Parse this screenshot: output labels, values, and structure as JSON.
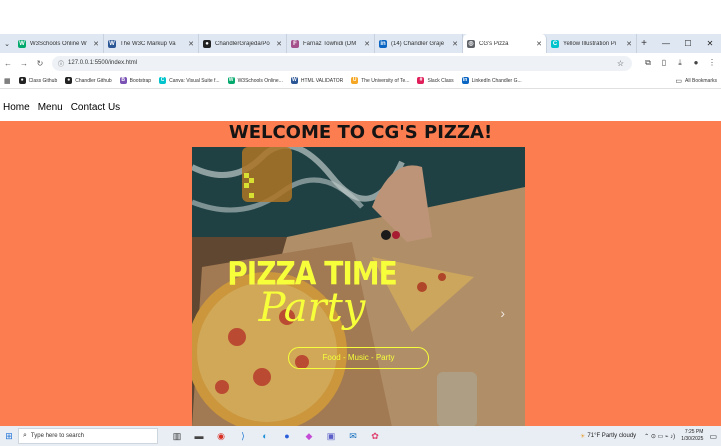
{
  "browser": {
    "tabs": [
      {
        "title": "W3Schools Online W",
        "icon": "w3schools-icon",
        "color": "#04aa6d",
        "glyph": "W"
      },
      {
        "title": "The W3C Markup Va",
        "icon": "w3c-icon",
        "color": "#2b5797",
        "glyph": "W"
      },
      {
        "title": "ChandlerGrajeda/Po",
        "icon": "github-icon",
        "color": "#222222",
        "glyph": "●"
      },
      {
        "title": "Farnaz Towhidi (DM",
        "icon": "profile-icon",
        "color": "#a4508b",
        "glyph": "F"
      },
      {
        "title": "(14) Chandler Graje",
        "icon": "linkedin-icon",
        "color": "#0a66c2",
        "glyph": "in"
      },
      {
        "title": "CG's Pizza",
        "icon": "globe-icon",
        "color": "#5f6368",
        "glyph": "◎",
        "active": true
      },
      {
        "title": "Yellow Illustration Pi",
        "icon": "canva-icon",
        "color": "#00c4cc",
        "glyph": "C"
      }
    ],
    "url": "127.0.0.1:5500/index.html",
    "bookmarks": [
      {
        "label": "Class Github",
        "icon": "github-icon",
        "color": "#222222",
        "glyph": "●"
      },
      {
        "label": "Chandler Github",
        "icon": "github-icon",
        "color": "#222222",
        "glyph": "●"
      },
      {
        "label": "Bootstrap",
        "icon": "bootstrap-icon",
        "color": "#7952b3",
        "glyph": "B"
      },
      {
        "label": "Canva: Visual Suite f...",
        "icon": "canva-icon",
        "color": "#00c4cc",
        "glyph": "C"
      },
      {
        "label": "W3Schools Online...",
        "icon": "w3schools-icon",
        "color": "#04aa6d",
        "glyph": "W"
      },
      {
        "label": "HTML VALIDATOR",
        "icon": "w3c-icon",
        "color": "#2b5797",
        "glyph": "W"
      },
      {
        "label": "The University of Te...",
        "icon": "university-icon",
        "color": "#f5a623",
        "glyph": "U"
      },
      {
        "label": "Slack Class",
        "icon": "slack-icon",
        "color": "#e01e5a",
        "glyph": "#"
      },
      {
        "label": "LinkedIn Chandler G...",
        "icon": "linkedin-icon",
        "color": "#0a66c2",
        "glyph": "in"
      }
    ],
    "all_bookmarks": "All Bookmarks"
  },
  "site": {
    "nav": [
      "Home",
      "Menu",
      "Contact Us"
    ],
    "heading": "WELCOME TO CG'S PIZZA!",
    "hero": {
      "title": "PIZZA TIME",
      "script": "Party",
      "tagline": "Food - Music - Party"
    },
    "colors": {
      "page_bg": "#fc7d50",
      "hero_text": "#f6ff3a"
    }
  },
  "taskbar": {
    "search_placeholder": "Type here to search",
    "weather": "71°F  Partly cloudy",
    "time": "7:25 PM",
    "date": "1/30/2025"
  }
}
